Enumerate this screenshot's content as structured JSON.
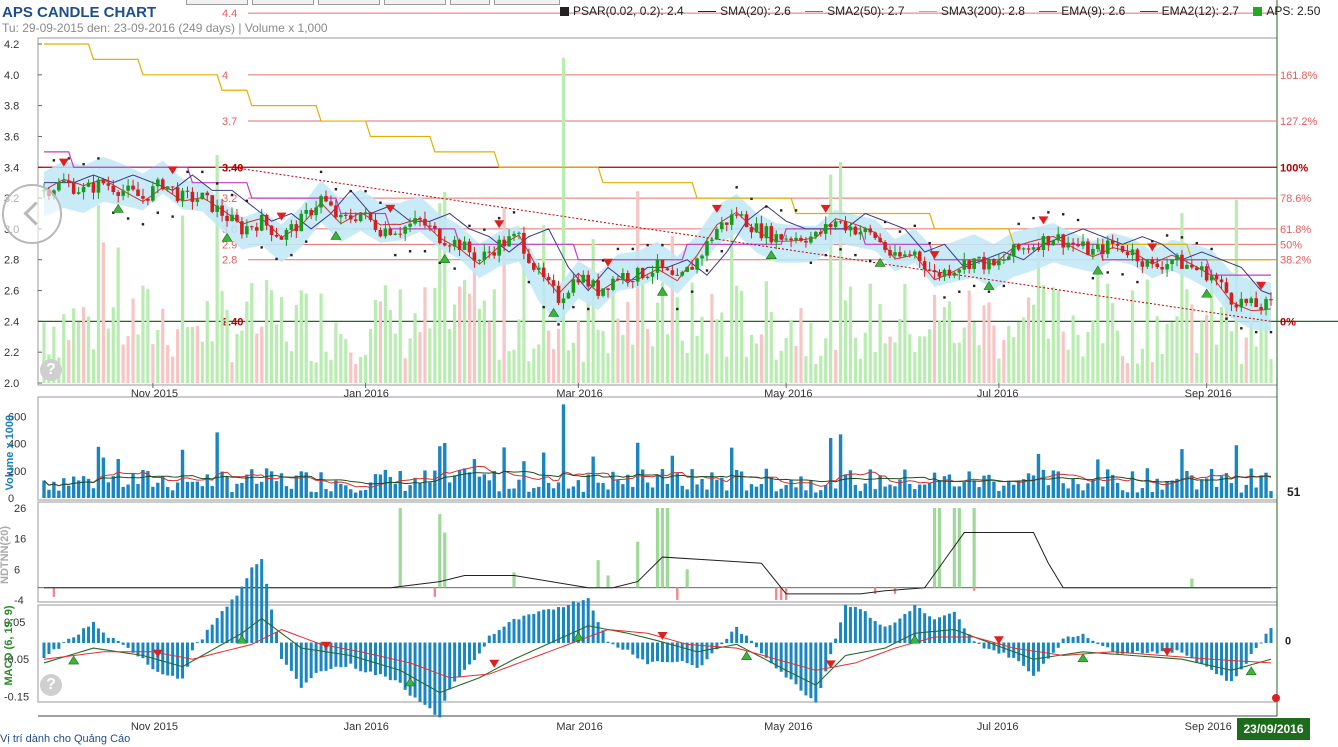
{
  "header": {
    "title": "APS CANDLE CHART",
    "subtitle": "Tu: 29-09-2015 den: 23-09-2016 (249 days) | Volume x 1,000"
  },
  "legend": [
    {
      "label": "PSAR(0.02, 0.2): 2.4",
      "kind": "square",
      "color": "#222222"
    },
    {
      "label": "SMA(20): 2.6",
      "kind": "line",
      "color": "#222222"
    },
    {
      "label": "SMA2(50): 2.7",
      "kind": "line",
      "color": "#c040c0"
    },
    {
      "label": "SMA3(200): 2.8",
      "kind": "line",
      "color": "#e0b000"
    },
    {
      "label": "EMA(9): 2.6",
      "kind": "line",
      "color": "#d03030"
    },
    {
      "label": "EMA2(12): 2.7",
      "kind": "line",
      "color": "#3a3a8a"
    },
    {
      "label": "APS: 2.50",
      "kind": "square",
      "color": "#22aa22"
    }
  ],
  "footer": {
    "text": "Vị trí dành cho Quảng Cáo",
    "date_badge": "23/09/2016",
    "last_volume": "51"
  },
  "help_icon_text": "?",
  "chart_data": [
    {
      "type": "candlestick",
      "name": "price",
      "x": [
        "Nov 2015",
        "Jan 2016",
        "Mar 2016",
        "May 2016",
        "Jul 2016",
        "Sep 2016"
      ],
      "ylim": [
        2.0,
        4.2
      ],
      "y_ticks": [
        "2.0",
        "2.2",
        "2.4",
        "2.6",
        "2.8",
        "3.0",
        "3.2",
        "3.4",
        "3.6",
        "3.8",
        "4.0",
        "4.2"
      ],
      "close_path": [
        [
          0,
          3.25
        ],
        [
          4,
          3.3
        ],
        [
          8,
          3.25
        ],
        [
          12,
          3.3
        ],
        [
          16,
          3.25
        ],
        [
          20,
          3.2
        ],
        [
          24,
          3.3
        ],
        [
          28,
          3.2
        ],
        [
          32,
          3.2
        ],
        [
          36,
          3.1
        ],
        [
          40,
          3.0
        ],
        [
          44,
          3.05
        ],
        [
          48,
          2.95
        ],
        [
          52,
          3.05
        ],
        [
          56,
          3.2
        ],
        [
          60,
          3.05
        ],
        [
          64,
          3.1
        ],
        [
          68,
          3.0
        ],
        [
          72,
          3.0
        ],
        [
          76,
          3.05
        ],
        [
          80,
          2.95
        ],
        [
          84,
          2.9
        ],
        [
          88,
          2.8
        ],
        [
          92,
          2.9
        ],
        [
          96,
          2.95
        ],
        [
          100,
          2.7
        ],
        [
          104,
          2.55
        ],
        [
          108,
          2.7
        ],
        [
          112,
          2.6
        ],
        [
          116,
          2.7
        ],
        [
          120,
          2.7
        ],
        [
          124,
          2.75
        ],
        [
          128,
          2.65
        ],
        [
          132,
          2.8
        ],
        [
          136,
          3.0
        ],
        [
          140,
          3.1
        ],
        [
          144,
          3.0
        ],
        [
          148,
          2.95
        ],
        [
          152,
          2.95
        ],
        [
          156,
          2.95
        ],
        [
          160,
          3.05
        ],
        [
          164,
          3.0
        ],
        [
          168,
          2.95
        ],
        [
          172,
          2.8
        ],
        [
          176,
          2.85
        ],
        [
          180,
          2.7
        ],
        [
          184,
          2.75
        ],
        [
          188,
          2.8
        ],
        [
          192,
          2.75
        ],
        [
          196,
          2.85
        ],
        [
          200,
          2.9
        ],
        [
          204,
          2.95
        ],
        [
          208,
          2.9
        ],
        [
          212,
          2.85
        ],
        [
          216,
          2.9
        ],
        [
          220,
          2.85
        ],
        [
          224,
          2.75
        ],
        [
          228,
          2.8
        ],
        [
          232,
          2.75
        ],
        [
          236,
          2.7
        ],
        [
          240,
          2.55
        ],
        [
          244,
          2.5
        ],
        [
          248,
          2.5
        ]
      ],
      "fib_levels": [
        {
          "pct": "0%",
          "value": 2.4,
          "label": "2.40"
        },
        {
          "pct": "38.2%",
          "value": 2.8,
          "label": "2.8"
        },
        {
          "pct": "50%",
          "value": 2.9,
          "label": "2.9"
        },
        {
          "pct": "61.8%",
          "value": 3.0,
          "label": "3.0"
        },
        {
          "pct": "78.6%",
          "value": 3.2,
          "label": "3.2"
        },
        {
          "pct": "100%",
          "value": 3.4,
          "label": "3.40"
        },
        {
          "pct": "127.2%",
          "value": 3.7,
          "label": "3.7"
        },
        {
          "pct": "161.8%",
          "value": 4.0,
          "label": "4"
        },
        {
          "pct": "",
          "value": 4.4,
          "label": "4.4"
        }
      ],
      "sma200_steps": [
        [
          0,
          4.2
        ],
        [
          10,
          4.1
        ],
        [
          20,
          4.0
        ],
        [
          36,
          3.9
        ],
        [
          42,
          3.8
        ],
        [
          56,
          3.7
        ],
        [
          66,
          3.6
        ],
        [
          79,
          3.5
        ],
        [
          92,
          3.4
        ],
        [
          113,
          3.3
        ],
        [
          132,
          3.2
        ],
        [
          152,
          3.1
        ],
        [
          180,
          3.0
        ],
        [
          196,
          2.9
        ],
        [
          232,
          2.8
        ],
        [
          248,
          2.8
        ]
      ],
      "sma50_steps": [
        [
          0,
          3.5
        ],
        [
          6,
          3.4
        ],
        [
          30,
          3.3
        ],
        [
          42,
          3.2
        ],
        [
          60,
          3.1
        ],
        [
          70,
          3.0
        ],
        [
          84,
          2.9
        ],
        [
          108,
          2.8
        ],
        [
          130,
          2.9
        ],
        [
          150,
          3.0
        ],
        [
          166,
          2.9
        ],
        [
          180,
          2.8
        ],
        [
          196,
          2.9
        ],
        [
          214,
          2.8
        ],
        [
          236,
          2.7
        ],
        [
          248,
          2.7
        ]
      ]
    },
    {
      "type": "bar",
      "name": "volume",
      "ylabel": "Volume x 1000",
      "ylim": [
        0,
        700
      ],
      "y_ticks": [
        "0",
        "200",
        "400",
        "600"
      ],
      "peak_day": 105,
      "peak_value": 690,
      "last_value": 51
    },
    {
      "type": "bar",
      "name": "foreign-net",
      "ylabel": "NDTNN(20)",
      "ylim": [
        -4,
        26
      ],
      "y_ticks": [
        "-4",
        "6",
        "16",
        "26"
      ],
      "spikes": [
        [
          72,
          26
        ],
        [
          80,
          24
        ],
        [
          81,
          18
        ],
        [
          95,
          5
        ],
        [
          112,
          9
        ],
        [
          114,
          4
        ],
        [
          120,
          15
        ],
        [
          124,
          26
        ],
        [
          125,
          26
        ],
        [
          126,
          26
        ],
        [
          130,
          6
        ],
        [
          180,
          26
        ],
        [
          181,
          26
        ],
        [
          184,
          26
        ],
        [
          185,
          26
        ],
        [
          188,
          26
        ],
        [
          232,
          3
        ]
      ],
      "neg_spikes": [
        [
          2,
          -3
        ],
        [
          79,
          -3
        ],
        [
          128,
          -4
        ],
        [
          148,
          -4
        ],
        [
          149,
          -4
        ],
        [
          150,
          -4
        ],
        [
          168,
          -2
        ],
        [
          172,
          -2
        ],
        [
          188,
          -1
        ]
      ],
      "line_path": [
        [
          0,
          0
        ],
        [
          20,
          0
        ],
        [
          40,
          0
        ],
        [
          70,
          0
        ],
        [
          80,
          2
        ],
        [
          85,
          4
        ],
        [
          95,
          4
        ],
        [
          110,
          0
        ],
        [
          115,
          0
        ],
        [
          120,
          2
        ],
        [
          125,
          10
        ],
        [
          135,
          9
        ],
        [
          145,
          8
        ],
        [
          150,
          -2
        ],
        [
          165,
          -2
        ],
        [
          170,
          -1
        ],
        [
          178,
          0
        ],
        [
          182,
          9
        ],
        [
          186,
          18
        ],
        [
          200,
          18
        ],
        [
          203,
          8
        ],
        [
          206,
          0
        ],
        [
          248,
          0
        ]
      ]
    },
    {
      "type": "line",
      "name": "macd",
      "ylabel": "MACD (6, 19, 9)",
      "ylim": [
        -0.16,
        0.08
      ],
      "y_ticks": [
        "-0.15",
        "-0.05",
        "0.05"
      ],
      "right_labels": [
        "0",
        "-0.1"
      ],
      "macd_path": [
        [
          0,
          -0.06
        ],
        [
          10,
          -0.02
        ],
        [
          20,
          -0.04
        ],
        [
          28,
          -0.07
        ],
        [
          40,
          0.02
        ],
        [
          44,
          0.06
        ],
        [
          52,
          -0.02
        ],
        [
          62,
          -0.04
        ],
        [
          72,
          -0.08
        ],
        [
          80,
          -0.14
        ],
        [
          88,
          -0.1
        ],
        [
          95,
          -0.05
        ],
        [
          100,
          -0.02
        ],
        [
          110,
          0.04
        ],
        [
          118,
          0.02
        ],
        [
          124,
          0.0
        ],
        [
          132,
          -0.03
        ],
        [
          140,
          -0.01
        ],
        [
          150,
          -0.08
        ],
        [
          156,
          -0.12
        ],
        [
          162,
          -0.04
        ],
        [
          170,
          -0.02
        ],
        [
          176,
          0.02
        ],
        [
          184,
          0.03
        ],
        [
          192,
          -0.01
        ],
        [
          200,
          -0.05
        ],
        [
          210,
          -0.03
        ],
        [
          220,
          -0.04
        ],
        [
          230,
          -0.05
        ],
        [
          240,
          -0.08
        ],
        [
          248,
          -0.05
        ]
      ],
      "signal_path": [
        [
          0,
          -0.05
        ],
        [
          12,
          -0.03
        ],
        [
          22,
          -0.03
        ],
        [
          30,
          -0.05
        ],
        [
          42,
          -0.01
        ],
        [
          48,
          0.03
        ],
        [
          56,
          -0.01
        ],
        [
          64,
          -0.03
        ],
        [
          74,
          -0.06
        ],
        [
          82,
          -0.1
        ],
        [
          90,
          -0.09
        ],
        [
          98,
          -0.05
        ],
        [
          106,
          -0.01
        ],
        [
          114,
          0.03
        ],
        [
          122,
          0.02
        ],
        [
          130,
          -0.01
        ],
        [
          140,
          -0.02
        ],
        [
          148,
          -0.05
        ],
        [
          156,
          -0.08
        ],
        [
          164,
          -0.06
        ],
        [
          172,
          -0.02
        ],
        [
          180,
          0.01
        ],
        [
          188,
          0.01
        ],
        [
          196,
          -0.02
        ],
        [
          206,
          -0.04
        ],
        [
          216,
          -0.03
        ],
        [
          226,
          -0.04
        ],
        [
          236,
          -0.05
        ],
        [
          248,
          -0.06
        ]
      ]
    }
  ]
}
